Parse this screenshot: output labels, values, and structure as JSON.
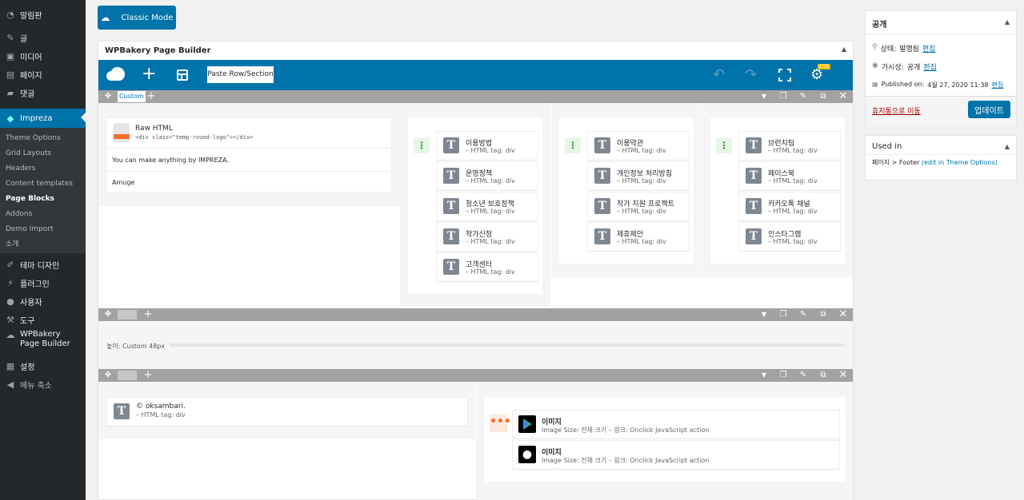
{
  "sidebar": {
    "items": [
      {
        "label": "알림판",
        "icon": "dashboard-icon",
        "glyph": "◔"
      },
      {
        "label": "글",
        "icon": "pin-icon",
        "glyph": "✎"
      },
      {
        "label": "미디어",
        "icon": "media-icon",
        "glyph": "▣"
      },
      {
        "label": "페이지",
        "icon": "page-icon",
        "glyph": "▤"
      },
      {
        "label": "댓글",
        "icon": "comment-icon",
        "glyph": "▰"
      },
      {
        "label": "Impreza",
        "icon": "diamond-icon",
        "glyph": "◆"
      },
      {
        "label": "테마 디자인",
        "icon": "brush-icon",
        "glyph": "✐"
      },
      {
        "label": "플러그인",
        "icon": "plugin-icon",
        "glyph": "⚡"
      },
      {
        "label": "사용자",
        "icon": "user-icon",
        "glyph": "●"
      },
      {
        "label": "도구",
        "icon": "wrench-icon",
        "glyph": "⚒"
      },
      {
        "label": "WPBakery Page Builder",
        "icon": "wpbakery-icon",
        "glyph": "☁"
      },
      {
        "label": "설정",
        "icon": "settings-icon",
        "glyph": "▦"
      },
      {
        "label": "메뉴 축소",
        "icon": "collapse-icon",
        "glyph": "◀"
      }
    ],
    "submenu": [
      "Theme Options",
      "Grid Layouts",
      "Headers",
      "Content templates",
      "Page Blocks",
      "Addons",
      "Demo Import",
      "소개"
    ]
  },
  "classic_mode": "Classic Mode",
  "builder": {
    "title": "WPBakery Page Builder",
    "paste": "Paste Row/Section",
    "custom_tab": "Custom",
    "settings_badge": "CSS",
    "raw_html": {
      "title": "Raw HTML",
      "code": "<div class=\"temp-round-logo\"></div>",
      "text1": "You can make anything by IMPREZA.",
      "text2": "Amuge"
    },
    "html_tag": "– HTML tag: div",
    "col2": [
      "이용방법",
      "운영정책",
      "청소년 보호정책",
      "작가신청",
      "고객센터"
    ],
    "col3": [
      "이용약관",
      "개인정보 처리방침",
      "작가 지원 프로젝트",
      "제휴제안"
    ],
    "col4": [
      "브런치팀",
      "페이스북",
      "카카오톡 채널",
      "인스타그램"
    ],
    "spacer": "높이: Custom  48px",
    "copyright": "© oksambari.",
    "image_title": "이미지",
    "image_meta": "Image Size: 전체 크기   – 링크: Onclick JavaScript action"
  },
  "publish": {
    "title": "공개",
    "status_label": "상태:",
    "status_value": "발행됨",
    "visibility_label": "가시성:",
    "visibility_value": "공개",
    "published_label": "Published on:",
    "published_value": "4월 27, 2020 11:38",
    "edit": "편집",
    "trash": "휴지통으로 이동",
    "update": "업데이트"
  },
  "used_in": {
    "title": "Used in",
    "text": "페이지 > Footer",
    "link": "(edit in Theme Options)"
  },
  "colors": {
    "accent": "#0073aa",
    "sidebar": "#23282d",
    "row_bar": "#a2a2a2",
    "handle": "#2ea02e",
    "orange": "#f56e28"
  }
}
